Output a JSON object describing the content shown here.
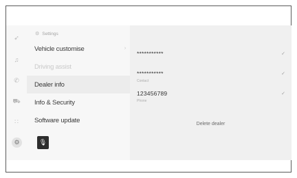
{
  "breadcrumb": {
    "title": "Settings"
  },
  "rail": {
    "icons": [
      "navigation-icon",
      "music-icon",
      "phone-icon",
      "vehicle-icon",
      "apps-icon",
      "settings-icon"
    ]
  },
  "menu": {
    "items": [
      {
        "label": "Vehicle customise",
        "state": "normal"
      },
      {
        "label": "Driving assist",
        "state": "disabled"
      },
      {
        "label": "Dealer info",
        "state": "active"
      },
      {
        "label": "Info & Security",
        "state": "normal"
      },
      {
        "label": "Software update",
        "state": "normal"
      }
    ]
  },
  "dealer": {
    "name_value": "***********",
    "contact_value": "***********",
    "contact_label": "Contact",
    "phone_value": "123456789",
    "phone_label": "Phone",
    "delete_label": "Delete dealer"
  }
}
